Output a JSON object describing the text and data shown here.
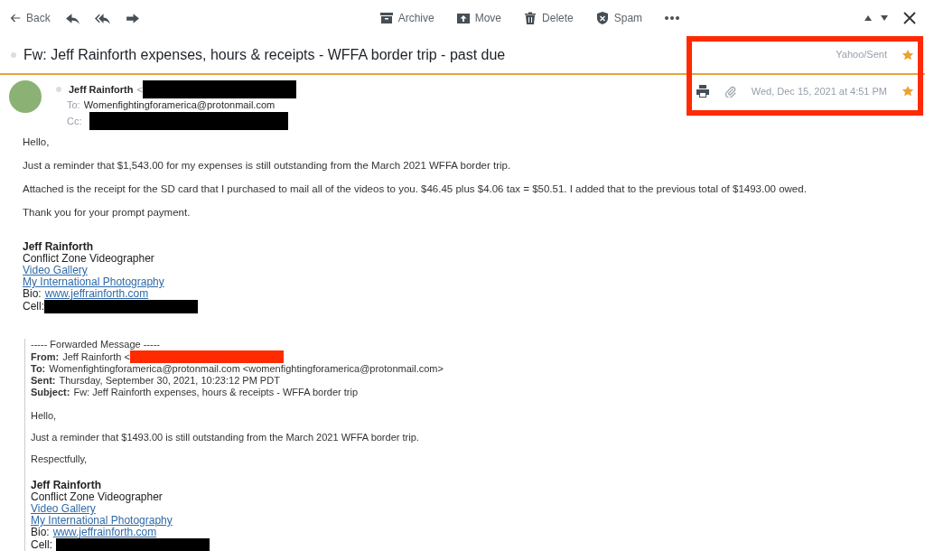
{
  "toolbar": {
    "back": "Back",
    "actions": [
      {
        "kind": "archive",
        "label": "Archive"
      },
      {
        "kind": "move",
        "label": "Move"
      },
      {
        "kind": "delete",
        "label": "Delete"
      },
      {
        "kind": "spam",
        "label": "Spam"
      }
    ]
  },
  "subject": {
    "text": "Fw: Jeff Rainforth expenses, hours & receipts - WFFA border trip - past due",
    "folder": "Yahoo/Sent",
    "starred": true
  },
  "message": {
    "sender": "Jeff Rainforth",
    "sender_suffix": "<",
    "to_label": "To:",
    "to": "Womenfightingforamerica@protonmail.com",
    "cc_label": "Cc:",
    "date": "Wed, Dec 15, 2021 at 4:51 PM",
    "starred": true
  },
  "body": {
    "paragraphs": [
      "Hello,",
      "Just a reminder that $1,543.00 for my expenses is still outstanding from the March 2021 WFFA border trip.",
      "Attached is the receipt for the SD card that I purchased to mail all of the videos to you. $46.45 plus $4.06 tax = $50.51. I added that to the previous total of $1493.00 owed.",
      "Thank you for your prompt payment."
    ],
    "signature": {
      "name": "Jeff Rainforth",
      "title": "Conflict Zone Videographer",
      "links": [
        "Video Gallery",
        "My International Photography"
      ],
      "bio_label": "Bio:",
      "bio_link": "www.jeffrainforth.com",
      "cell_label": "Cell:"
    }
  },
  "forwarded": {
    "header": "----- Forwarded Message -----",
    "fields": [
      {
        "label": "From:",
        "value": "Jeff Rainforth <",
        "redacted": true
      },
      {
        "label": "To:",
        "value": "Womenfightingforamerica@protonmail.com <womenfightingforamerica@protonmail.com>",
        "redacted": false
      },
      {
        "label": "Sent:",
        "value": "Thursday, September 30, 2021, 10:23:12 PM PDT",
        "redacted": false
      },
      {
        "label": "Subject:",
        "value": "Fw: Jeff Rainforth expenses, hours & receipts - WFFA border trip",
        "redacted": false
      }
    ],
    "paragraphs": [
      "Hello,",
      "Just a reminder that $1493.00 is still outstanding from the March 2021 WFFA border trip.",
      "Respectfully,"
    ],
    "signature": {
      "name": "Jeff Rainforth",
      "title": "Conflict Zone Videographer",
      "links": [
        "Video Gallery",
        "My International Photography"
      ],
      "bio_label": "Bio:",
      "bio_link": "www.jeffrainforth.com",
      "cell_label": "Cell:"
    }
  }
}
